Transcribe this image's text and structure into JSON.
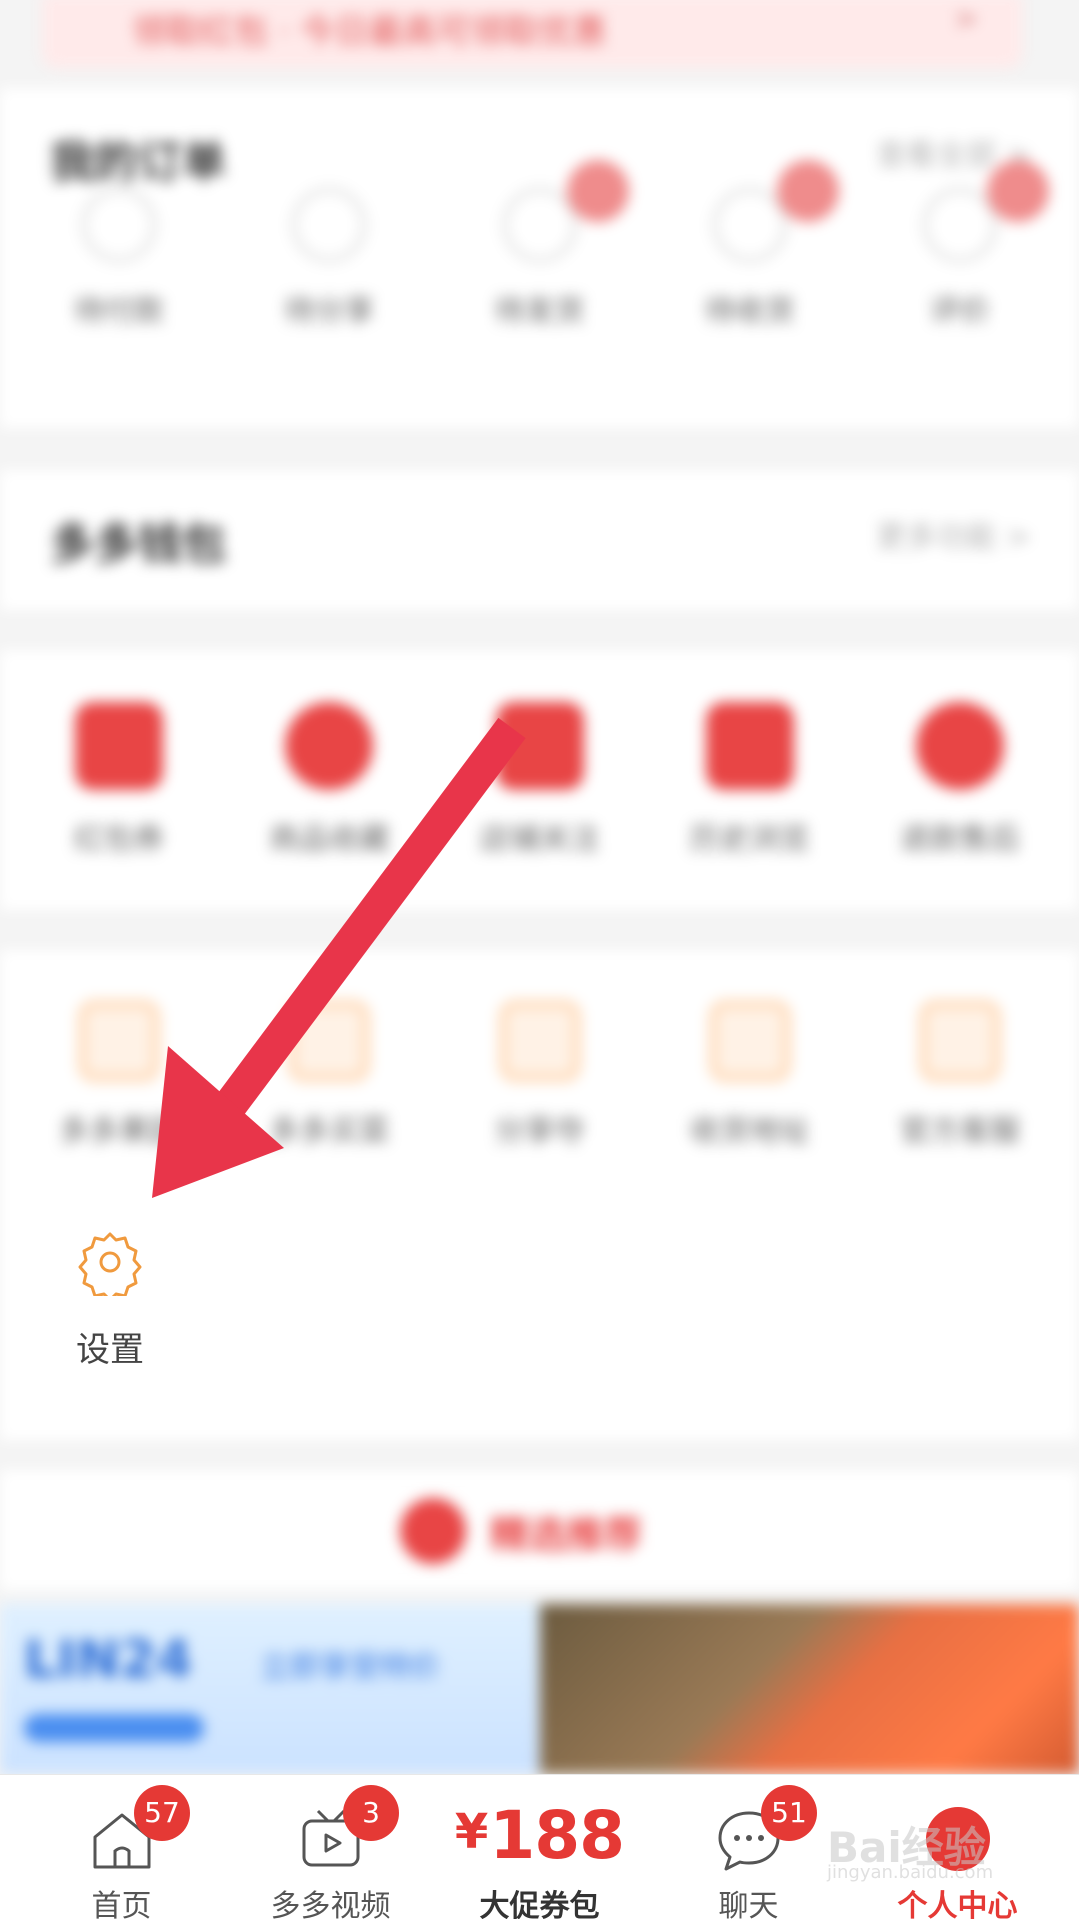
{
  "top_banner": {
    "text": "领取红包 · 今日最高可领取优惠",
    "chevron": ">"
  },
  "order_section": {
    "title": "我的订单",
    "link": "查看全部 >",
    "items": [
      {
        "label": "待付款",
        "badge": false
      },
      {
        "label": "待分享",
        "badge": false
      },
      {
        "label": "待发货",
        "badge": true
      },
      {
        "label": "待收货",
        "badge": true
      },
      {
        "label": "评价",
        "badge": true
      }
    ]
  },
  "wallet_section": {
    "title": "多多钱包",
    "link": "更多功能 >"
  },
  "promo_row": [
    {
      "label": "红包券"
    },
    {
      "label": "商品收藏"
    },
    {
      "label": "店铺关注"
    },
    {
      "label": "历史浏览"
    },
    {
      "label": "退款售后"
    }
  ],
  "service_row": [
    {
      "label": "多多果园"
    },
    {
      "label": "多多买菜"
    },
    {
      "label": "分享夺"
    },
    {
      "label": "收货地址"
    },
    {
      "label": "官方客服"
    }
  ],
  "settings": {
    "label": "设置",
    "icon": "gear-icon"
  },
  "recommend": {
    "title": "精选推荐"
  },
  "banner": {
    "left_title": "LIN24",
    "left_sub": "立即享受特价"
  },
  "bottom_nav": {
    "home": {
      "label": "首页",
      "badge": "57"
    },
    "video": {
      "label": "多多视频",
      "badge": "3"
    },
    "coupon": {
      "currency": "¥",
      "amount": "188",
      "label": "大促券包"
    },
    "chat": {
      "label": "聊天",
      "badge": "51"
    },
    "me": {
      "label": "个人中心"
    }
  },
  "watermark": {
    "brand": "Bai经验",
    "url": "jingyan.baidu.com"
  },
  "colors": {
    "accent_red": "#e53935",
    "arrow_red": "#e8354a",
    "orange": "#f09a3e"
  }
}
